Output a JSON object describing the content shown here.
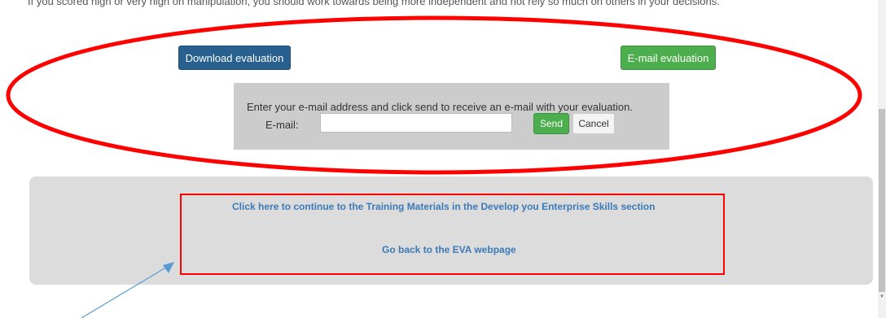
{
  "page": {
    "intro_text": "If you scored high or very high on manipulation, you should work towards being more independent and not rely so much on others in your decisions."
  },
  "evaluation": {
    "download_label": "Download evaluation",
    "email_label": "E-mail evaluation"
  },
  "email_form": {
    "instruction": "Enter your e-mail address and click send to receive an e-mail with your evaluation.",
    "field_label": "E-mail:",
    "field_value": "",
    "send_label": "Send",
    "cancel_label": "Cancel"
  },
  "links": {
    "training_materials": "Click here to continue to the Training Materials in the Develop you Enterprise Skills section",
    "eva_back": "Go back to the EVA webpage"
  },
  "colors": {
    "primary_button": "#286090",
    "success_button": "#4cae4c",
    "link": "#3a7ab8",
    "annotation_red": "#ff0000",
    "annotation_arrow": "#5b9bd5"
  }
}
